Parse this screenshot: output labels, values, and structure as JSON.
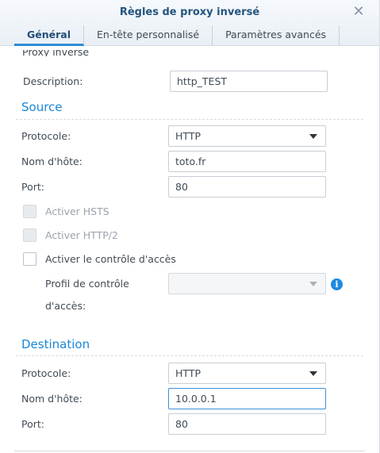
{
  "dialog": {
    "title": "Règles de proxy inversé",
    "close_icon": "close-icon",
    "tabs": [
      {
        "label": "Général",
        "active": true
      },
      {
        "label": "En-tête personnalisé",
        "active": false
      },
      {
        "label": "Paramètres avancés",
        "active": false
      }
    ]
  },
  "general": {
    "cut_off_label": "Proxy inversé",
    "description_label": "Description:",
    "description_value": "http_TEST"
  },
  "source": {
    "heading": "Source",
    "protocol_label": "Protocole:",
    "protocol_value": "HTTP",
    "hostname_label": "Nom d'hôte:",
    "hostname_value": "toto.fr",
    "port_label": "Port:",
    "port_value": "80",
    "hsts_label": "Activer HSTS",
    "http2_label": "Activer HTTP/2",
    "access_control_label": "Activer le contrôle d'accès",
    "access_profile_label_line1": "Profil de contrôle",
    "access_profile_label_line2": "d'accès:",
    "access_profile_value": ""
  },
  "destination": {
    "heading": "Destination",
    "protocol_label": "Protocole:",
    "protocol_value": "HTTP",
    "hostname_label": "Nom d'hôte:",
    "hostname_value": "10.0.0.1",
    "port_label": "Port:",
    "port_value": "80"
  },
  "colors": {
    "accent": "#1a86d8",
    "title": "#24557f",
    "text": "#414b55"
  }
}
